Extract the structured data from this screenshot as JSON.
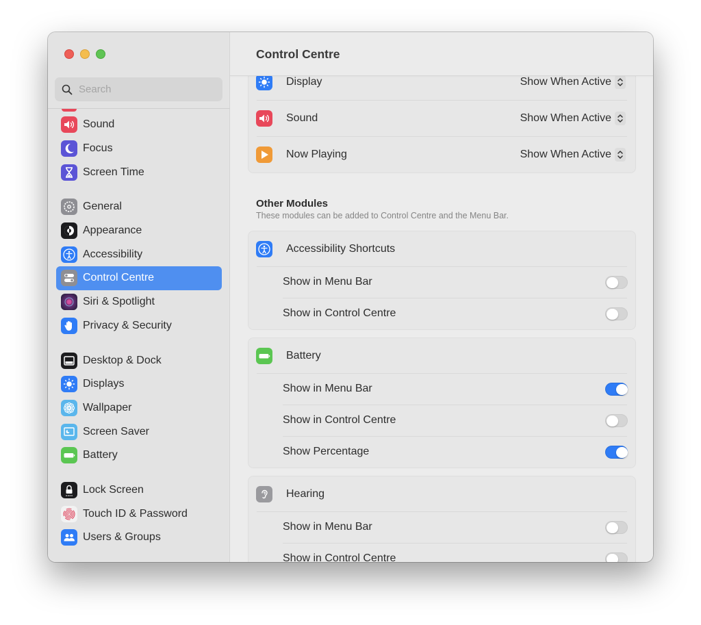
{
  "window": {
    "traffic_lights": [
      "close",
      "minimize",
      "maximize"
    ]
  },
  "sidebar": {
    "search": {
      "placeholder": "Search",
      "value": ""
    },
    "items": [
      {
        "label": "Sound",
        "icon": "sound-icon",
        "color": "#e8485a"
      },
      {
        "label": "Focus",
        "icon": "focus-moon-icon",
        "color": "#5b54d6"
      },
      {
        "label": "Screen Time",
        "icon": "hourglass-icon",
        "color": "#5b54d6"
      },
      {
        "label": "General",
        "icon": "gear-icon",
        "color": "#8e8e93"
      },
      {
        "label": "Appearance",
        "icon": "appearance-icon",
        "color": "#1c1c1e"
      },
      {
        "label": "Accessibility",
        "icon": "accessibility-icon",
        "color": "#2f7cf6"
      },
      {
        "label": "Control Centre",
        "icon": "control-centre-icon",
        "color": "#8e8e93",
        "active": true
      },
      {
        "label": "Siri & Spotlight",
        "icon": "siri-icon",
        "color": "#5a2b6e"
      },
      {
        "label": "Privacy & Security",
        "icon": "hand-icon",
        "color": "#2f7cf6"
      },
      {
        "label": "Desktop & Dock",
        "icon": "dock-icon",
        "color": "#1c1c1e"
      },
      {
        "label": "Displays",
        "icon": "sun-icon",
        "color": "#2f7cf6"
      },
      {
        "label": "Wallpaper",
        "icon": "flower-icon",
        "color": "#5ab6ec"
      },
      {
        "label": "Screen Saver",
        "icon": "screensaver-icon",
        "color": "#5ab6ec"
      },
      {
        "label": "Battery",
        "icon": "battery-icon",
        "color": "#5bc652"
      },
      {
        "label": "Lock Screen",
        "icon": "lock-icon",
        "color": "#1c1c1e"
      },
      {
        "label": "Touch ID & Password",
        "icon": "fingerprint-icon",
        "color": "#f2f2f2"
      },
      {
        "label": "Users & Groups",
        "icon": "users-icon",
        "color": "#2f7cf6"
      }
    ]
  },
  "main": {
    "title": "Control Centre",
    "control_centre_modules": [
      {
        "label": "Display",
        "icon": "sun-icon",
        "value": "Show When Active"
      },
      {
        "label": "Sound",
        "icon": "sound-icon",
        "value": "Show When Active"
      },
      {
        "label": "Now Playing",
        "icon": "play-icon",
        "value": "Show When Active"
      }
    ],
    "other_modules": {
      "title": "Other Modules",
      "subtitle": "These modules can be added to Control Centre and the Menu Bar.",
      "groups": [
        {
          "label": "Accessibility Shortcuts",
          "icon": "accessibility-icon",
          "options": [
            {
              "label": "Show in Menu Bar",
              "on": false
            },
            {
              "label": "Show in Control Centre",
              "on": false
            }
          ]
        },
        {
          "label": "Battery",
          "icon": "battery-icon",
          "options": [
            {
              "label": "Show in Menu Bar",
              "on": true
            },
            {
              "label": "Show in Control Centre",
              "on": false
            },
            {
              "label": "Show Percentage",
              "on": true
            }
          ]
        },
        {
          "label": "Hearing",
          "icon": "ear-icon",
          "options": [
            {
              "label": "Show in Menu Bar",
              "on": false
            },
            {
              "label": "Show in Control Centre",
              "on": false
            }
          ]
        }
      ]
    }
  },
  "colors": {
    "accent": "#2f7cf6",
    "sidebar_selection": "#4f8ff0",
    "toggle_off": "#d5d5d5"
  }
}
